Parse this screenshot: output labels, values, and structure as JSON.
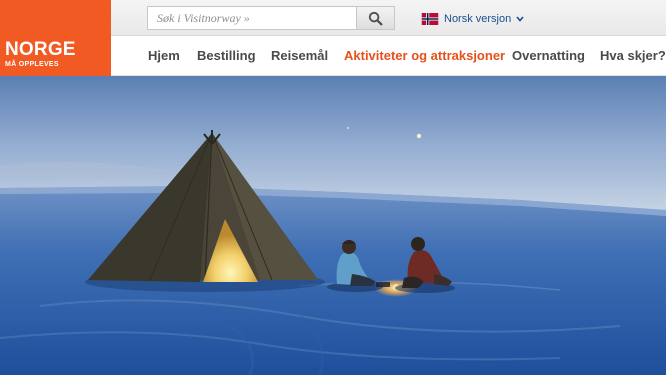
{
  "logo": {
    "title": "NORGE",
    "tagline": "MÅ OPPLEVES"
  },
  "search": {
    "placeholder": "Søk i Visitnorway »",
    "icon": "search-icon"
  },
  "language": {
    "label": "Norsk versjon",
    "flag": "norway-flag-icon"
  },
  "nav": {
    "items": [
      {
        "label": "Hjem",
        "active": false
      },
      {
        "label": "Bestilling",
        "active": false
      },
      {
        "label": "Reisemål",
        "active": false
      },
      {
        "label": "Aktiviteter og attraksjoner",
        "active": true
      },
      {
        "label": "Overnatting",
        "active": false
      },
      {
        "label": "Hva skjer?",
        "active": false
      }
    ]
  },
  "colors": {
    "brand": "#f15a22",
    "active_nav": "#e8501b",
    "nav_text": "#4a4a4a",
    "link": "#1a4f8f"
  },
  "hero": {
    "description_icon": "hero-photo-lavvo-snow"
  }
}
